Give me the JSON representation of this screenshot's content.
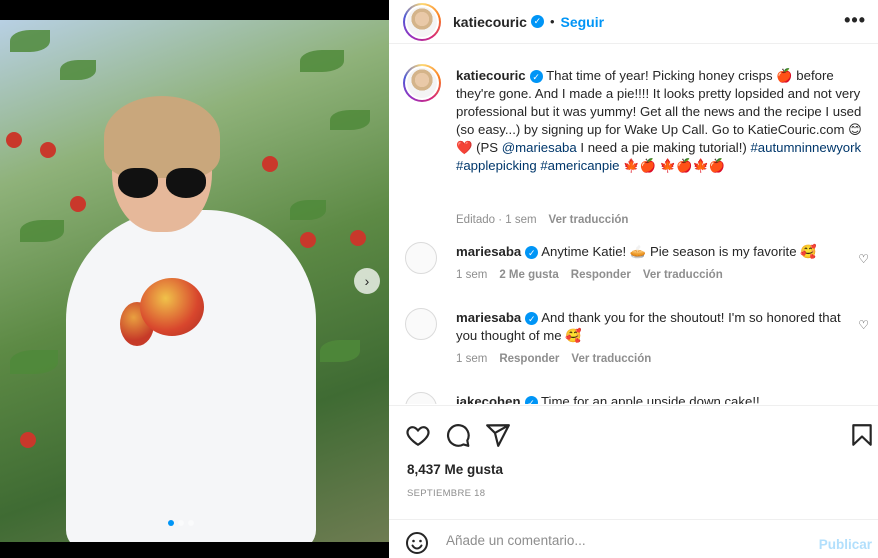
{
  "post": {
    "username": "katiecouric",
    "follow_label": "Seguir",
    "separator": "•",
    "more_label": "•••"
  },
  "caption": {
    "username": "katiecouric",
    "text_1": "That time of year! Picking honey crisps 🍎 before they're gone. And I made a pie!!!! It looks pretty lopsided and not very professional but it was yummy! Get all the news and the recipe I used (so easy...) by signing up for Wake Up Call. Go to KatieCouric.com 😊❤️ (PS ",
    "mention": "@mariesaba",
    "text_2": " I need a pie making tutorial!) ",
    "hashtags": "#autumninnewyork #applepicking #americanpie",
    "text_3": " 🍁🍎 🍁🍎🍁🍎",
    "edited": "Editado · 1 sem",
    "see_translation": "Ver traducción"
  },
  "comments": [
    {
      "username": "mariesaba",
      "text": "Anytime Katie! 🥧 Pie season is my favorite 🥰",
      "time": "1 sem",
      "likes": "2 Me gusta",
      "reply": "Responder",
      "translate": "Ver traducción"
    },
    {
      "username": "mariesaba",
      "text": "And thank you for the shoutout! I'm so honored that you thought of me 🥰",
      "time": "1 sem",
      "reply": "Responder",
      "translate": "Ver traducción"
    },
    {
      "username": "jakecohen",
      "text": "Time for an apple upside down cake!!"
    }
  ],
  "actions": {
    "likes": "8,437 Me gusta",
    "date": "SEPTIEMBRE 18",
    "heart_icon": "heart-icon",
    "comment_icon": "comment-icon",
    "share_icon": "share-icon",
    "save_icon": "bookmark-icon"
  },
  "add_comment": {
    "placeholder": "Añade un comentario...",
    "post_label": "Publicar"
  },
  "media": {
    "next_label": "›",
    "slides": 3,
    "active_slide": 1
  },
  "colors": {
    "accent": "#0095f6",
    "hashtag": "#00376b",
    "muted": "#8e8e8e",
    "post_disabled": "#b2dffc"
  }
}
